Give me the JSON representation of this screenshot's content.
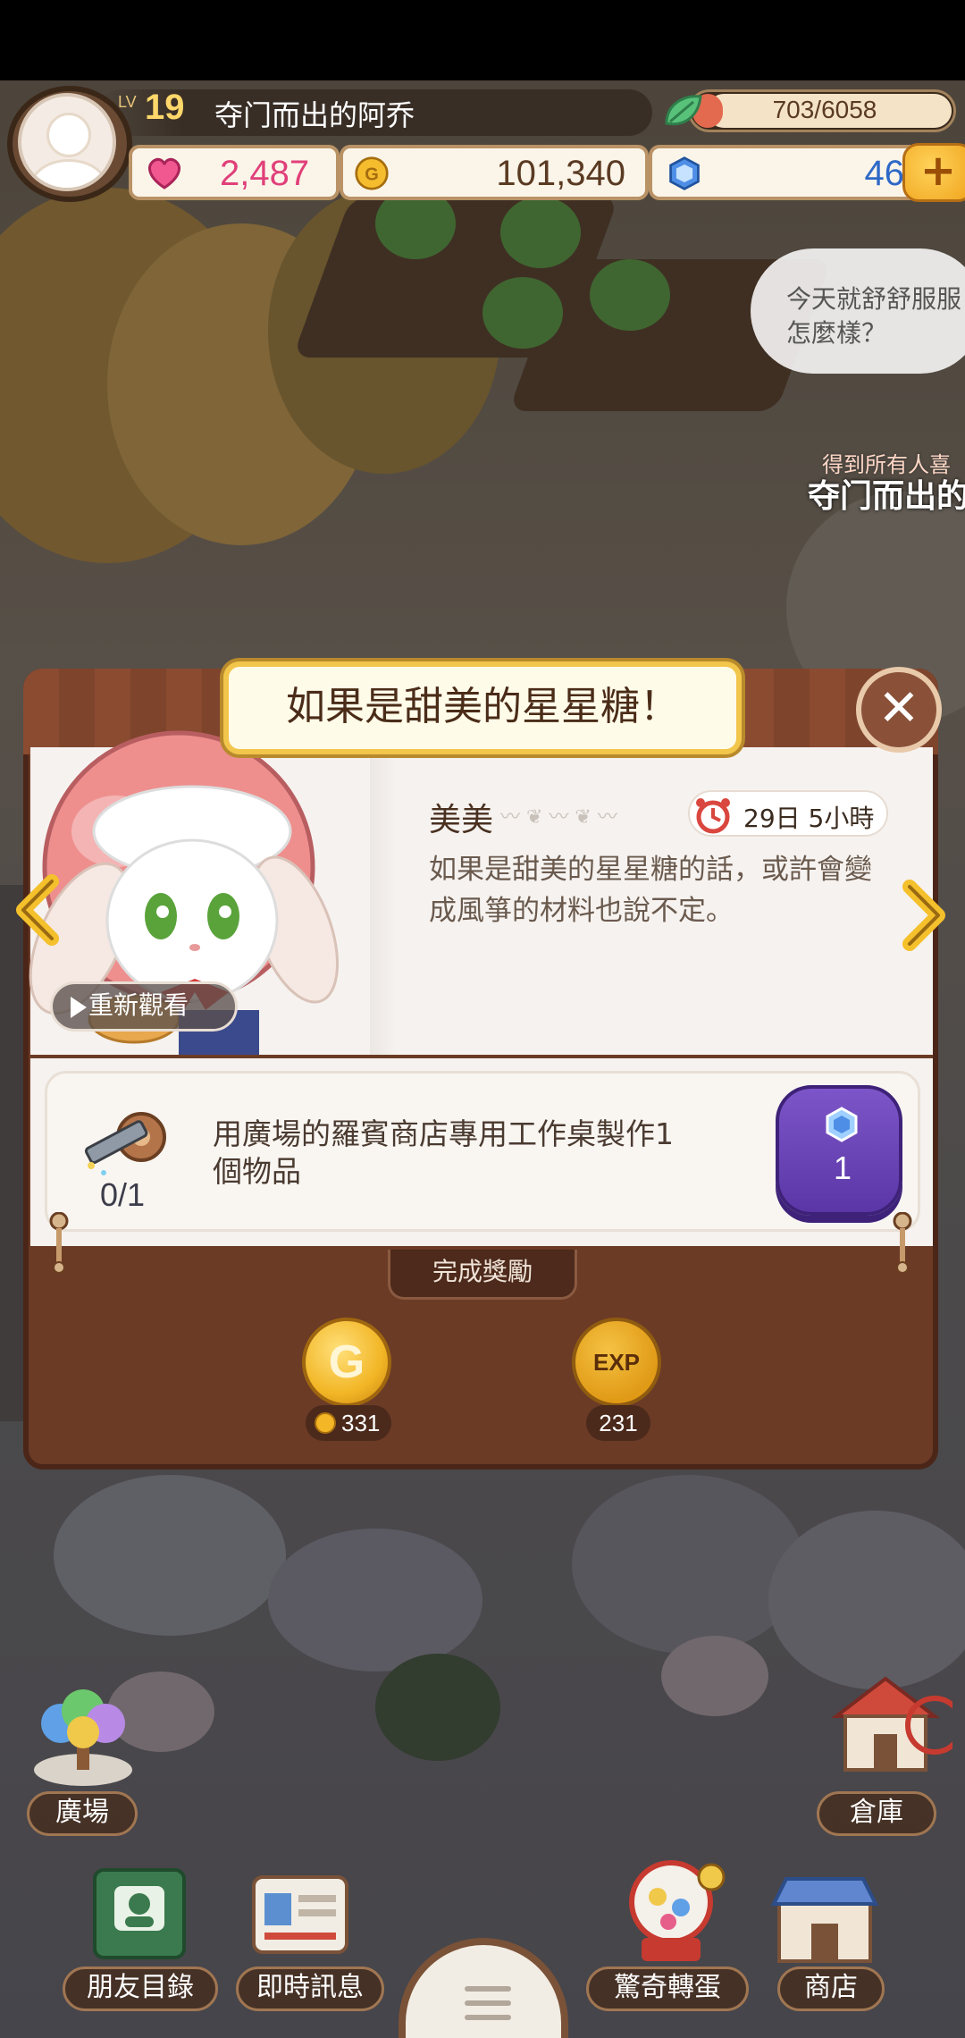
{
  "hud": {
    "level_label": "LV",
    "level": "19",
    "player_name": "夺门而出的阿乔",
    "energy": "703/6058",
    "energy_fraction": 0.116,
    "hearts": "2,487",
    "gold": "101,340",
    "gems": "46",
    "add_label": "+"
  },
  "world": {
    "speech_bubble": "今天就舒舒服服\n怎麼樣？",
    "thanks_line": "得到所有人喜",
    "thanks_name": "夺门而出的"
  },
  "popup": {
    "title": "如果是甜美的星星糖！",
    "close_label": "✕",
    "character_name": "美美",
    "timer": "29日 5小時",
    "story_text": "如果是甜美的星星糖的話，或許會變成風箏的材料也說不定。",
    "replay_label": "重新觀看",
    "task": {
      "description": "用廣場的羅賓商店專用工作桌製作1個物品",
      "progress": "0/1",
      "gem_reward": "1"
    },
    "reward_section_label": "完成獎勵",
    "rewards": {
      "gold_icon_letter": "G",
      "gold": "331",
      "exp_icon_label": "EXP",
      "exp": "231"
    }
  },
  "bottom_nav": {
    "plaza": "廣場",
    "warehouse": "倉庫",
    "friends": "朋友目錄",
    "messages": "即時訊息",
    "gacha": "驚奇轉蛋",
    "shop": "商店"
  },
  "colors": {
    "popup_brown": "#6b3b26",
    "title_gold": "#f2c54b",
    "gem_purple": "#5b36a6",
    "heart_pink": "#e0407a",
    "gem_blue": "#2e68c7"
  }
}
